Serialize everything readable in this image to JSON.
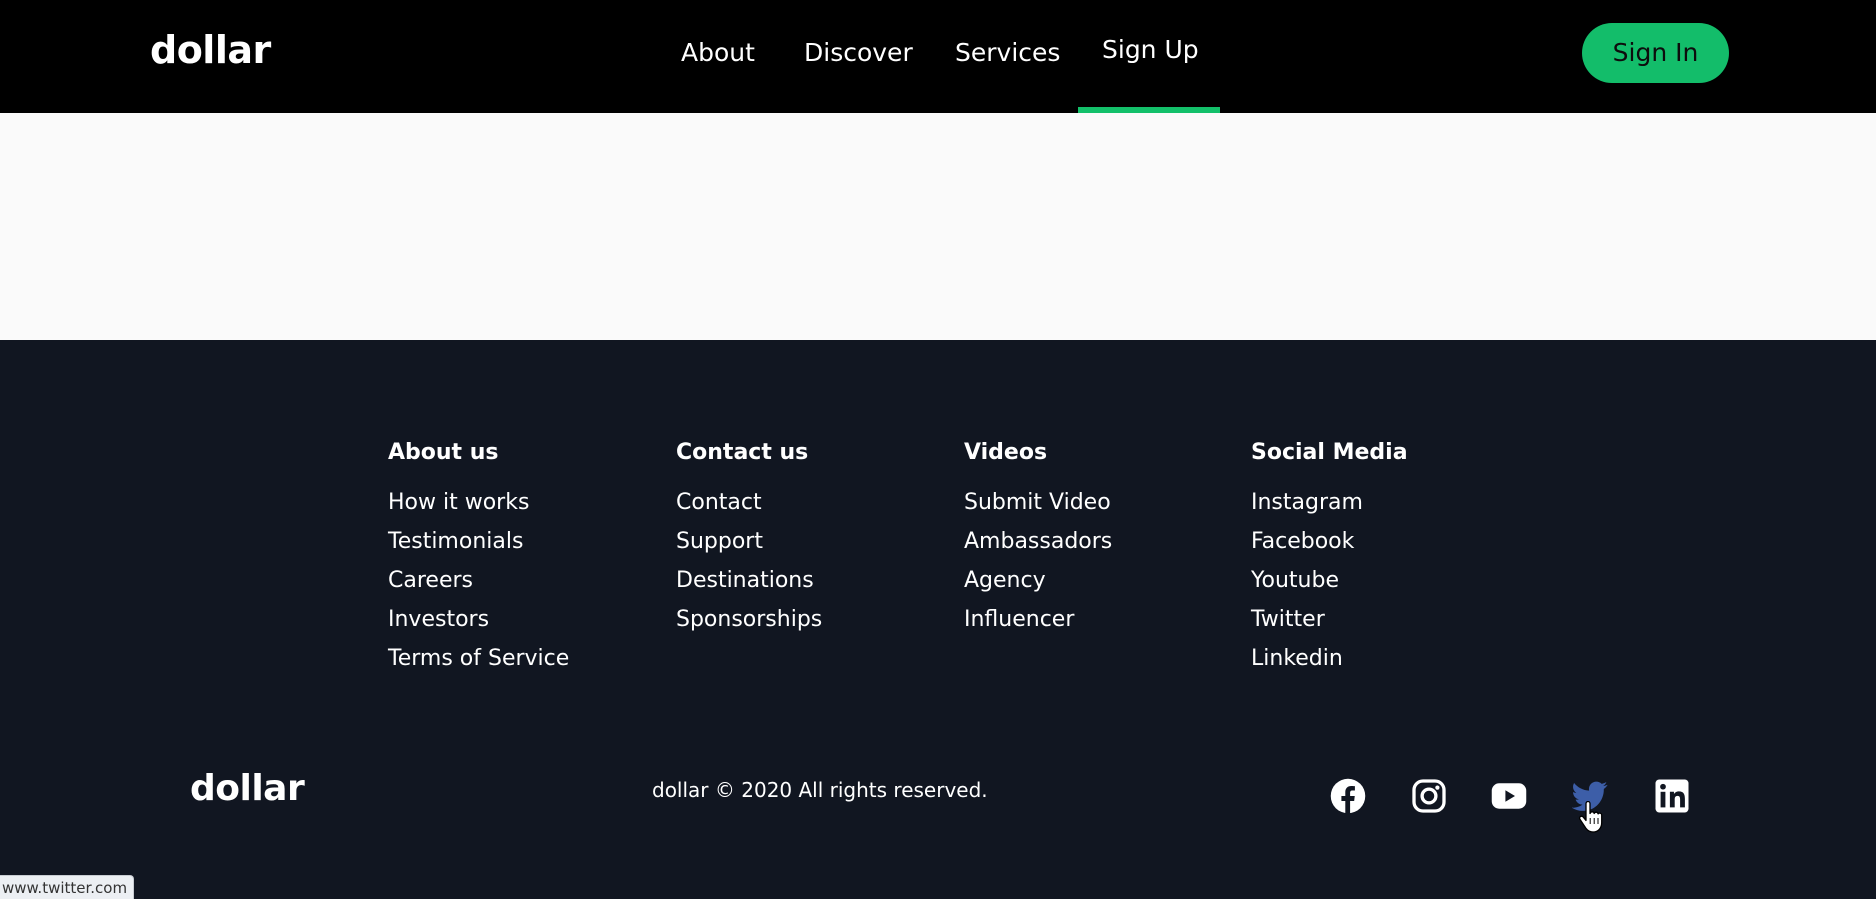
{
  "nav": {
    "logo": "dollar",
    "links": [
      {
        "label": "About"
      },
      {
        "label": "Discover"
      },
      {
        "label": "Services"
      },
      {
        "label": "Sign Up",
        "active": true
      }
    ],
    "signin_label": "Sign In",
    "accent_color": "#13bd6a"
  },
  "footer": {
    "columns": [
      {
        "heading": "About us",
        "links": [
          "How it works",
          "Testimonials",
          "Careers",
          "Investors",
          "Terms of Service"
        ]
      },
      {
        "heading": "Contact us",
        "links": [
          "Contact",
          "Support",
          "Destinations",
          "Sponsorships"
        ]
      },
      {
        "heading": "Videos",
        "links": [
          "Submit Video",
          "Ambassadors",
          "Agency",
          "Influencer"
        ]
      },
      {
        "heading": "Social Media",
        "links": [
          "Instagram",
          "Facebook",
          "Youtube",
          "Twitter",
          "Linkedin"
        ]
      }
    ],
    "logo": "dollar",
    "copyright": "dollar © 2020 All rights reserved.",
    "social_icons": [
      {
        "name": "facebook-icon"
      },
      {
        "name": "instagram-icon"
      },
      {
        "name": "youtube-icon"
      },
      {
        "name": "twitter-icon",
        "hovered": true,
        "color": "#3d5ea8"
      },
      {
        "name": "linkedin-icon"
      }
    ],
    "background_color": "#111621"
  },
  "status_bar": {
    "url": "www.twitter.com"
  }
}
